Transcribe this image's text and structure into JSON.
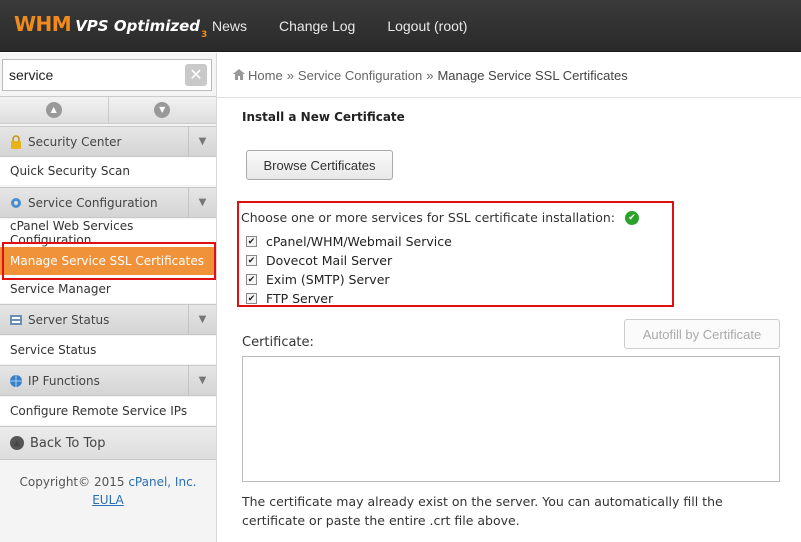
{
  "header": {
    "logo_main": "WHM",
    "logo_sub": "VPS Optimized",
    "logo_ver": "3",
    "nav": [
      "News",
      "Change Log",
      "Logout (root)"
    ]
  },
  "sidebar": {
    "search_value": "service",
    "sections": [
      {
        "label": "Security Center",
        "icon": "lock-icon",
        "items": [
          "Quick Security Scan"
        ]
      },
      {
        "label": "Service Configuration",
        "icon": "gear-icon",
        "items": [
          "cPanel Web Services Configuration",
          "Manage Service SSL Certificates",
          "Service Manager"
        ]
      },
      {
        "label": "Server Status",
        "icon": "server-icon",
        "items": [
          "Service Status"
        ]
      },
      {
        "label": "IP Functions",
        "icon": "globe-icon",
        "items": [
          "Configure Remote Service IPs"
        ]
      }
    ],
    "active_item": "Manage Service SSL Certificates",
    "back_to_top": "Back To Top",
    "copyright_prefix": "Copyright© 2015",
    "copyright_link": "cPanel, Inc.",
    "eula": "EULA"
  },
  "breadcrumb": {
    "home": "Home",
    "sep": "»",
    "level1": "Service Configuration",
    "current": "Manage Service SSL Certificates"
  },
  "main": {
    "title": "Install a New Certificate",
    "browse_label": "Browse Certificates",
    "services_prompt": "Choose one or more services for SSL certificate installation:",
    "services": [
      {
        "label": "cPanel/WHM/Webmail Service",
        "checked": true
      },
      {
        "label": "Dovecot Mail Server",
        "checked": true
      },
      {
        "label": "Exim (SMTP) Server",
        "checked": true
      },
      {
        "label": "FTP Server",
        "checked": true
      }
    ],
    "certificate_label": "Certificate:",
    "autofill_label": "Autofill by Certificate",
    "help_text": "The certificate may already exist on the server. You can automatically fill the certificate or paste the entire .crt file above."
  },
  "colors": {
    "accent": "#f0923a",
    "highlight_box": "#e01010",
    "topbar": "#2f2f2f",
    "link": "#2a6fb5",
    "ok_green": "#29a329"
  }
}
